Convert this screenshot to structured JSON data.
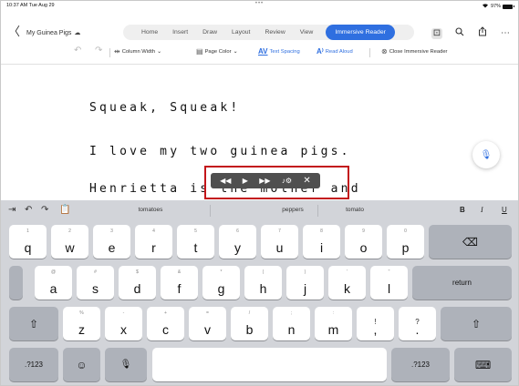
{
  "status_bar": {
    "time": "10:37 AM  Tue Aug 29",
    "dots": "•••",
    "wifi_icon": "wifi-icon",
    "battery": "97%"
  },
  "nav": {
    "back_glyph": "〈",
    "doc_title": "My Guinea Pigs",
    "tabs": [
      "Home",
      "Insert",
      "Draw",
      "Layout",
      "Review",
      "View"
    ],
    "active_tab": "Immersive Reader"
  },
  "ribbon": {
    "column_width": "Column Width",
    "page_color": "Page Color",
    "text_spacing": "Text Spacing",
    "read_aloud": "Read Aloud",
    "close": "Close Immersive Reader"
  },
  "document": {
    "lines": [
      "Squeak, Squeak!",
      "I love my two guinea pigs.",
      "Henrietta is the mother and"
    ]
  },
  "keyboard": {
    "suggestions": [
      "tomatoes",
      "peppers",
      "tomato"
    ],
    "format": {
      "bold": "B",
      "italic": "I",
      "underline": "U"
    },
    "row1": [
      {
        "hint": "1",
        "key": "q"
      },
      {
        "hint": "2",
        "key": "w"
      },
      {
        "hint": "3",
        "key": "e"
      },
      {
        "hint": "4",
        "key": "r"
      },
      {
        "hint": "5",
        "key": "t"
      },
      {
        "hint": "6",
        "key": "y"
      },
      {
        "hint": "7",
        "key": "u"
      },
      {
        "hint": "8",
        "key": "i"
      },
      {
        "hint": "9",
        "key": "o"
      },
      {
        "hint": "0",
        "key": "p"
      }
    ],
    "row2": [
      {
        "hint": "@",
        "key": "a"
      },
      {
        "hint": "#",
        "key": "s"
      },
      {
        "hint": "$",
        "key": "d"
      },
      {
        "hint": "&",
        "key": "f"
      },
      {
        "hint": "*",
        "key": "g"
      },
      {
        "hint": "(",
        "key": "h"
      },
      {
        "hint": ")",
        "key": "j"
      },
      {
        "hint": "'",
        "key": "k"
      },
      {
        "hint": "\"",
        "key": "l"
      }
    ],
    "row3": [
      {
        "hint": "%",
        "key": "z"
      },
      {
        "hint": "-",
        "key": "x"
      },
      {
        "hint": "+",
        "key": "c"
      },
      {
        "hint": "=",
        "key": "v"
      },
      {
        "hint": "/",
        "key": "b"
      },
      {
        "hint": ";",
        "key": "n"
      },
      {
        "hint": ":",
        "key": "m"
      },
      {
        "hint": "!",
        "key": ","
      },
      {
        "hint": "?",
        "key": "."
      }
    ],
    "return_label": "return",
    "numbers_label": ".?123"
  },
  "colors": {
    "accent": "#2f6fe0",
    "highlight_box": "#c3151a",
    "keyboard_bg": "#d2d4d9"
  }
}
